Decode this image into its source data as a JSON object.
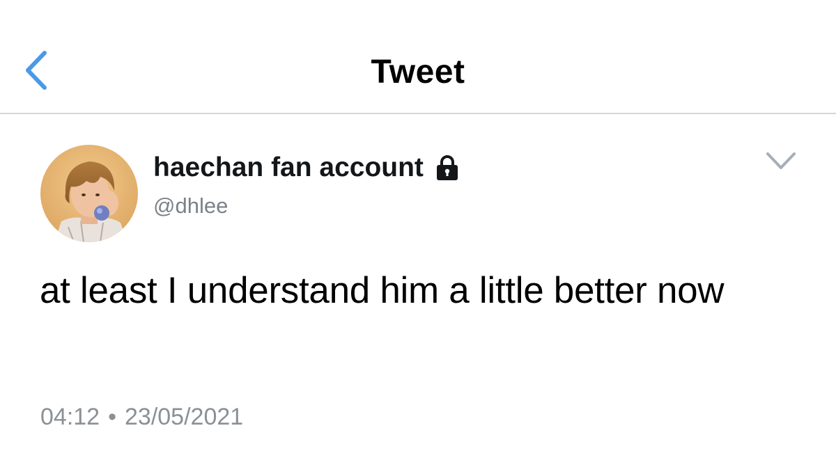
{
  "header": {
    "title": "Tweet",
    "back_icon": "chevron-left-icon",
    "accent_color": "#4a99e9"
  },
  "tweet": {
    "author": {
      "display_name": "haechan fan account",
      "handle": "@dhlee",
      "protected_icon": "lock-icon",
      "avatar": "profile-photo"
    },
    "menu_icon": "chevron-down-icon",
    "text": "at least I understand him a little better now",
    "time": "04:12",
    "separator": "•",
    "date": "23/05/2021"
  },
  "colors": {
    "text_primary": "#000000",
    "text_secondary": "#7a8289",
    "divider": "#d6d6d6"
  }
}
